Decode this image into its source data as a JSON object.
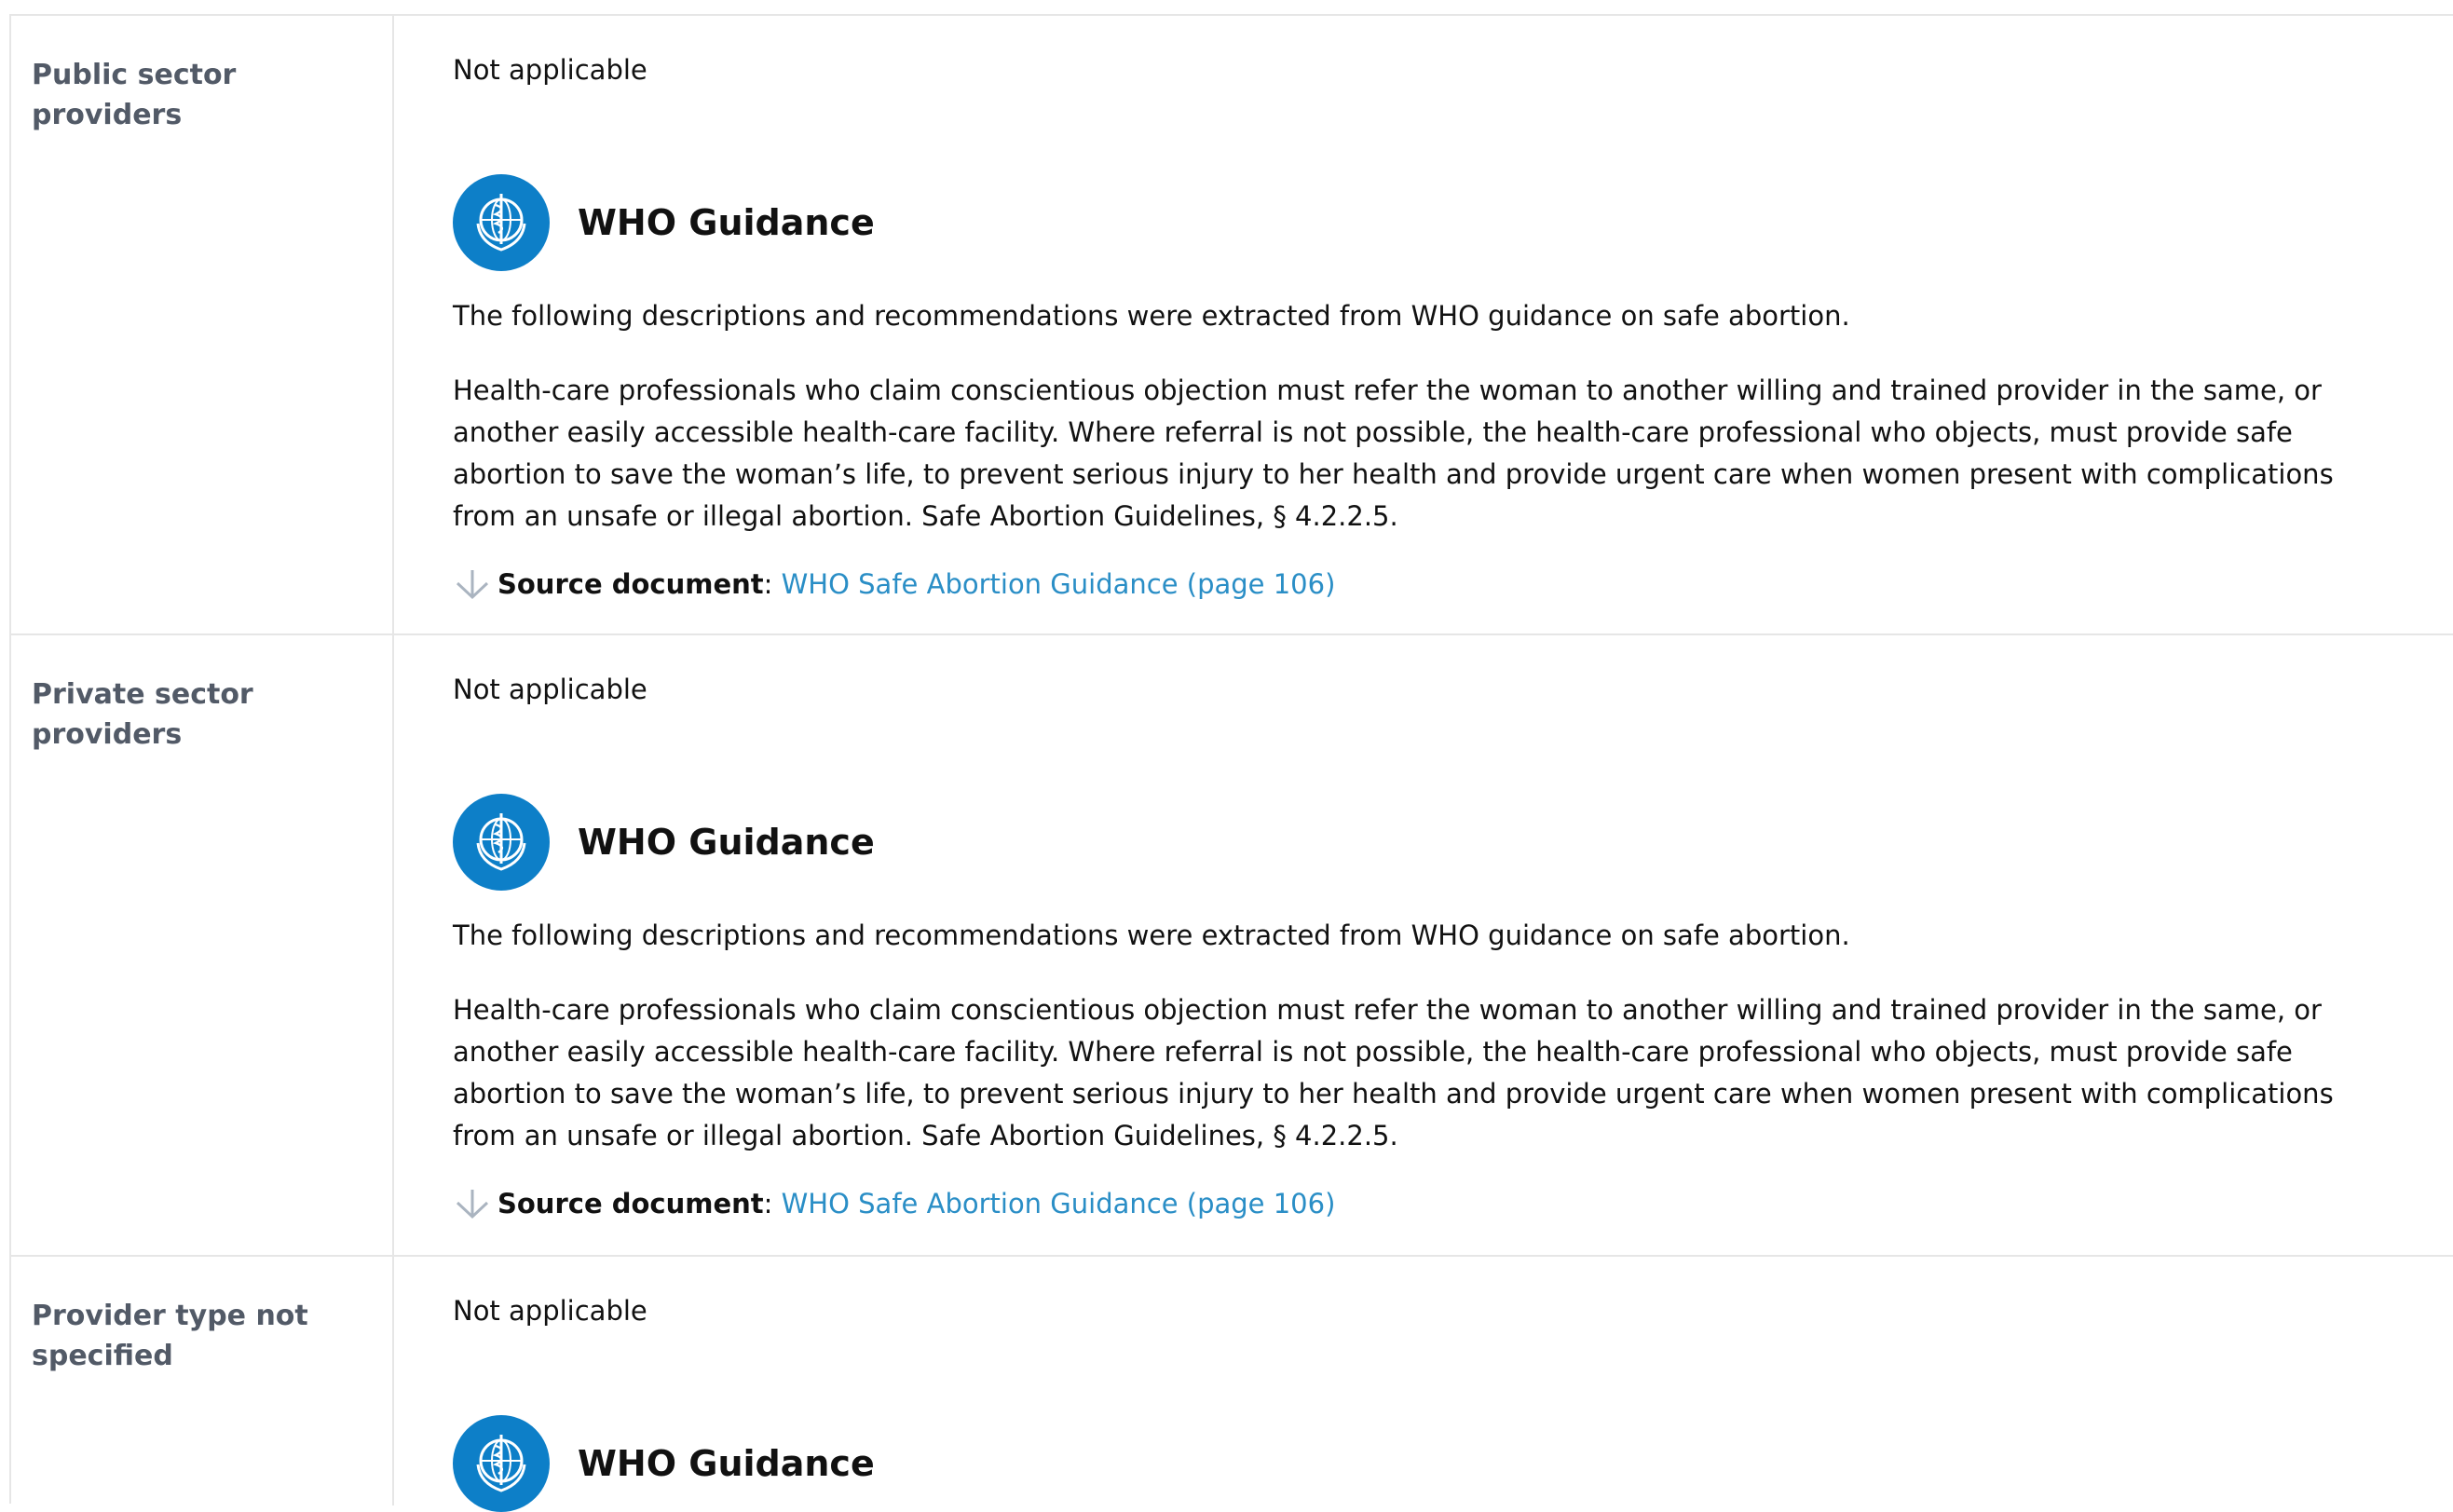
{
  "rows": [
    {
      "label": "Public sector providers",
      "status": "Not applicable",
      "who_title": "WHO Guidance",
      "intro": "The following descriptions and recommendations were extracted from WHO guidance on safe abortion.",
      "body": "Health-care professionals who claim conscientious objection must refer the woman to another willing and trained provider in the same, or another easily accessible health-care facility. Where referral is not possible, the health-care professional who objects, must provide safe abortion to save the woman’s life, to prevent serious injury to her health and provide urgent care when women present with complications from an unsafe or illegal abortion. Safe Abortion Guidelines, § 4.2.2.5.",
      "source_label": "Source document",
      "source_sep": ":",
      "source_link": "WHO Safe Abortion Guidance (page 106)"
    },
    {
      "label": "Private sector providers",
      "status": "Not applicable",
      "who_title": "WHO Guidance",
      "intro": "The following descriptions and recommendations were extracted from WHO guidance on safe abortion.",
      "body": "Health-care professionals who claim conscientious objection must refer the woman to another willing and trained provider in the same, or another easily accessible health-care facility. Where referral is not possible, the health-care professional who objects, must provide safe abortion to save the woman’s life, to prevent serious injury to her health and provide urgent care when women present with complications from an unsafe or illegal abortion. Safe Abortion Guidelines, § 4.2.2.5.",
      "source_label": "Source document",
      "source_sep": ":",
      "source_link": "WHO Safe Abortion Guidance (page 106)"
    },
    {
      "label": "Provider type not specified",
      "status": "Not applicable",
      "who_title": "WHO Guidance"
    }
  ],
  "colors": {
    "label": "#525a67",
    "who_blue": "#0d7fc8",
    "link": "#2a8ec6",
    "divider": "#e6e6e6",
    "arrow": "#aab4c0"
  },
  "icons": {
    "logo": "who-emblem-icon",
    "source": "arrow-down-icon"
  }
}
